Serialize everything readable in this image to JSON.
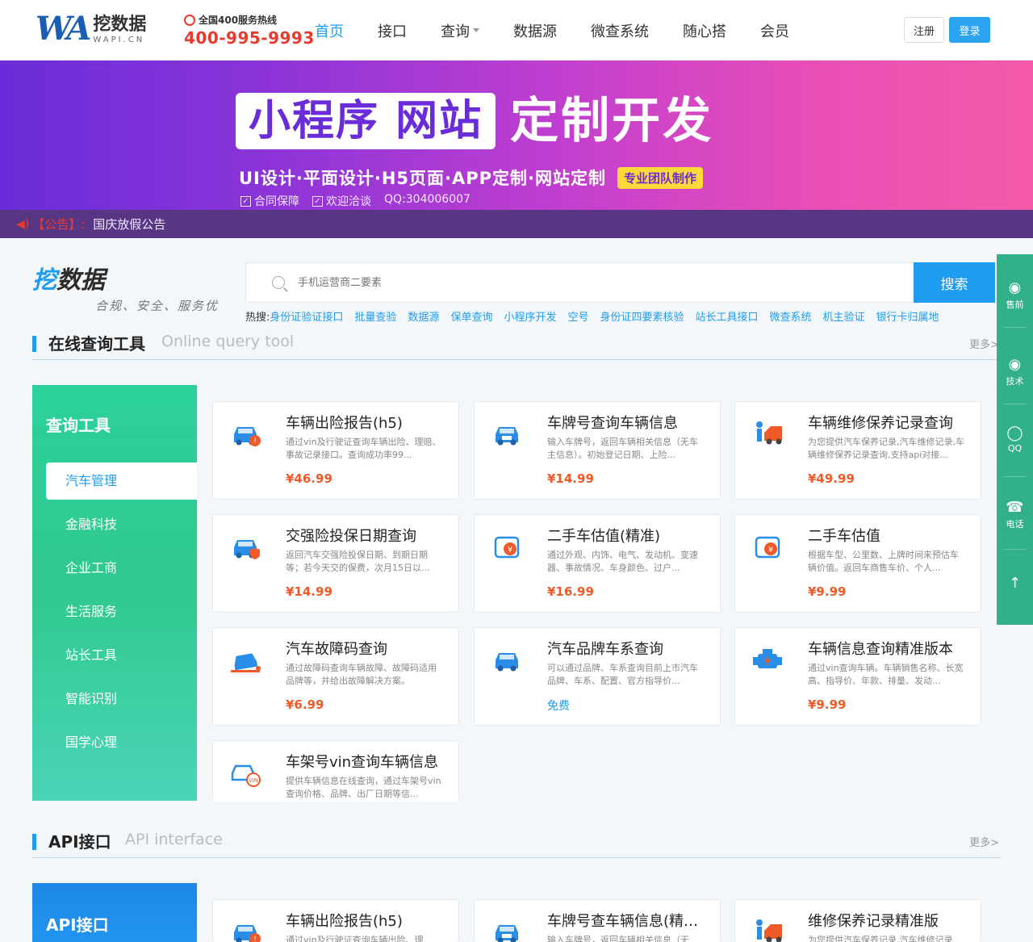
{
  "header": {
    "logo_mark": "WA",
    "logo_cn": "挖数据",
    "logo_en": "WAPI.CN",
    "hotline_label": "全国400服务热线",
    "hotline_number": "400-995-9993",
    "nav": [
      {
        "label": "首页",
        "active": true
      },
      {
        "label": "接口"
      },
      {
        "label": "查询",
        "dropdown": true
      },
      {
        "label": "数据源"
      },
      {
        "label": "微查系统"
      },
      {
        "label": "随心搭"
      },
      {
        "label": "会员"
      }
    ],
    "register_label": "注册",
    "login_label": "登录"
  },
  "banner": {
    "box_text": "小程序 网站",
    "main_text": "定制开发",
    "sub_text": "UI设计·平面设计·H5页面·APP定制·网站定制",
    "tag": "专业团队制作",
    "checks": [
      "合同保障",
      "欢迎洽谈"
    ],
    "qq": "QQ:304006007"
  },
  "notice": {
    "label": "【公告】:",
    "text": "国庆放假公告"
  },
  "brand": {
    "name_part1": "挖",
    "name_part2": "数据",
    "slogan": "合规、安全、服务优"
  },
  "search": {
    "placeholder": "手机运营商二要素",
    "button": "搜索",
    "hot_label": "热搜:",
    "hot_links": [
      "身份证验证接口",
      "批量查验",
      "数据源",
      "保单查询",
      "小程序开发",
      "空号",
      "身份证四要素核验",
      "站长工具接口",
      "微查系统",
      "机主验证",
      "银行卡归属地"
    ]
  },
  "query_section": {
    "title": "在线查询工具",
    "subtitle": "Online query tool",
    "more": "更多>",
    "panel_title": "查询工具",
    "categories": [
      {
        "label": "汽车管理",
        "active": true
      },
      {
        "label": "金融科技"
      },
      {
        "label": "企业工商"
      },
      {
        "label": "生活服务"
      },
      {
        "label": "站长工具"
      },
      {
        "label": "智能识别"
      },
      {
        "label": "国学心理"
      }
    ],
    "cards": [
      {
        "title": "车辆出险报告(h5)",
        "desc": "通过vin及行驶证查询车辆出险、理赔、事故记录接口。查询成功率99...",
        "price": "¥46.99",
        "icon": "car-warning-icon"
      },
      {
        "title": "车牌号查询车辆信息",
        "desc": "输入车牌号，返回车辆相关信息（无车主信息）。初始登记日期、上险...",
        "price": "¥14.99",
        "icon": "car-plate-icon"
      },
      {
        "title": "车辆维修保养记录查询",
        "desc": "为您提供汽车保养记录,汽车维修记录,车辆维修保养记录查询,支持api对接...",
        "price": "¥49.99",
        "icon": "car-repair-icon"
      },
      {
        "title": "交强险投保日期查询",
        "desc": "返回汽车交强险投保日期、到期日期等；若今天交的保费，次月15日以...",
        "price": "¥14.99",
        "icon": "car-insurance-icon"
      },
      {
        "title": "二手车估值(精准)",
        "desc": "通过外观、内饰、电气、发动机、变速器、事故情况、车身颜色、过户...",
        "price": "¥16.99",
        "icon": "car-valuation-icon"
      },
      {
        "title": "二手车估值",
        "desc": "根据车型、公里数、上牌时间来预估车辆价值。返回车商售车价、个人...",
        "price": "¥9.99",
        "icon": "car-valuation-icon"
      },
      {
        "title": "汽车故障码查询",
        "desc": "通过故障码查询车辆故障、故障码适用品牌等，并给出故障解决方案。",
        "price": "¥6.99",
        "icon": "car-fault-icon"
      },
      {
        "title": "汽车品牌车系查询",
        "desc": "可以通过品牌、车系查询目前上市汽车品牌、车系、配置、官方指导价...",
        "price": "免费",
        "icon": "car-brand-icon",
        "free": true
      },
      {
        "title": "车辆信息查询精准版本",
        "desc": "通过vin查询车辆。车辆销售名称、长宽高、指导价、年款、排量、发动...",
        "price": "¥9.99",
        "icon": "engine-icon"
      },
      {
        "title": "车架号vin查询车辆信息",
        "desc": "提供车辆信息在线查询，通过车架号vin查询价格、品牌、出厂日期等信...",
        "price": "",
        "icon": "car-vin-icon"
      }
    ]
  },
  "api_section": {
    "title": "API接口",
    "subtitle": "API interface",
    "more": "更多>",
    "panel_title": "API接口",
    "cards": [
      {
        "title": "车辆出险报告(h5)",
        "desc": "通过vin及行驶证查询车辆出险、理",
        "icon": "car-warning-icon"
      },
      {
        "title": "车牌号查车辆信息(精准...",
        "desc": "输入车牌号，返回车辆相关信息（无",
        "icon": "car-plate-icon"
      },
      {
        "title": "维修保养记录精准版",
        "desc": "为您提供汽车保养记录,汽车维修记录",
        "icon": "car-repair-icon"
      }
    ]
  },
  "float_bar": [
    {
      "label": "售前",
      "icon": "wechat-icon"
    },
    {
      "label": "技术",
      "icon": "wechat-icon"
    },
    {
      "label": "QQ",
      "icon": "qq-icon"
    },
    {
      "label": "电话",
      "icon": "phone-icon"
    },
    {
      "label": "",
      "icon": "back-to-top-icon"
    }
  ],
  "colors": {
    "brand_blue": "#1e9cf0",
    "price_orange": "#f05a28",
    "panel_green": "#2cd19c",
    "hotline_red": "#e83a2e"
  }
}
